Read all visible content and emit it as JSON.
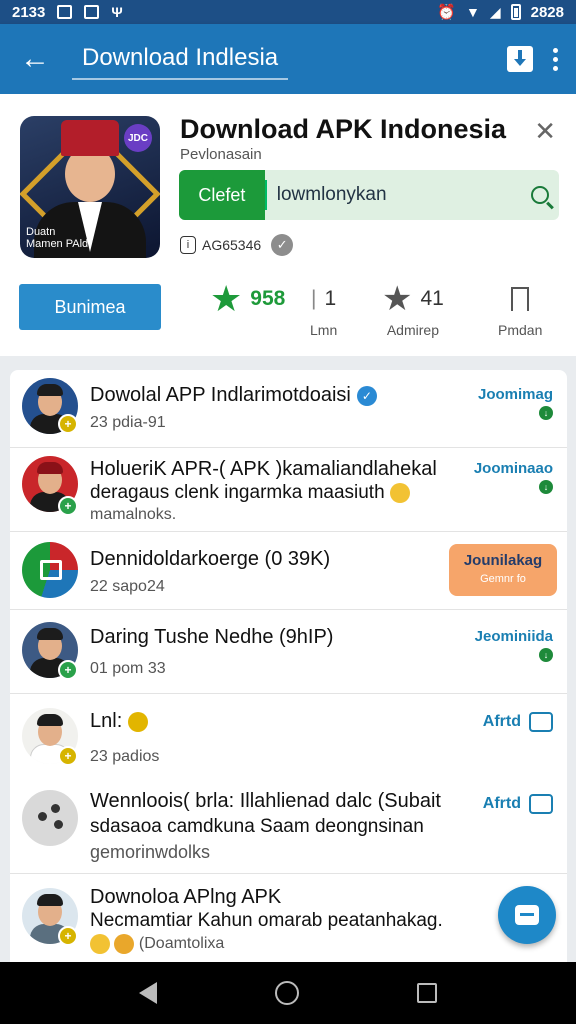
{
  "status_bar": {
    "time": "2133",
    "clock_right": "2828"
  },
  "app_bar": {
    "title": "Download Indlesia"
  },
  "header": {
    "app_title": "Download APK Indonesia",
    "developer": "Pevlonasain",
    "icon_badge": "JDC",
    "icon_caption_1": "Duatn",
    "icon_caption_2": "Mamen PAld",
    "search_button": "Clefet",
    "search_value": "lowmlonykan",
    "meta_code": "AG65346",
    "install_label": "Bunimea",
    "stats": [
      {
        "value": "958",
        "label": ""
      },
      {
        "value": "1",
        "label": "Lmn"
      },
      {
        "value": "41",
        "label": "Admirep"
      },
      {
        "value": "",
        "label": "Pmdan"
      }
    ]
  },
  "list": {
    "items": [
      {
        "title": "Dowolal APP Indlarimotdoaisi",
        "subtitle": "23 pdia-91",
        "action": "Joomimag"
      },
      {
        "title": "HolueriK APR-( APK )kamaliandlahekal",
        "desc": "deragaus clenk ingarmka maasiuth",
        "subtitle": "mamalnoks.",
        "action": "Joominaao"
      },
      {
        "title": "Dennidoldarkoerge (0 39K)",
        "subtitle": "22 sapo24",
        "action": "Jounilakag",
        "action_sub": "Gemnr fo"
      },
      {
        "title": "Daring Tushe Nedhe (9hIP)",
        "subtitle": "01 pom 33",
        "action": "Jeominiida"
      },
      {
        "title": "Lnl:",
        "subtitle": "23 padios",
        "action": "Afrtd"
      },
      {
        "title": "Wennloois( brla: Illahlienad dalc (Subait",
        "desc": "sdasaoa camdkuna Saam deongnsinan",
        "subtitle": "gemorinwdolks",
        "action": "Afrtd"
      },
      {
        "title": "Downoloa APlng APK",
        "desc": "Necmamtiar Kahun omarab peatanhakag.",
        "subtitle": "(Doamtolixa"
      }
    ]
  },
  "colors": {
    "app_bar": "#1e76b8",
    "status_bar": "#1d4f86",
    "accent_green": "#1c9a3a",
    "install_blue": "#2a8ccb",
    "action_orange": "#f6a56a"
  },
  "icons": [
    "back-arrow-icon",
    "download-icon",
    "more-icon",
    "close-icon",
    "search-icon",
    "star-icon",
    "bookmark-icon",
    "chat-icon",
    "compose-icon"
  ]
}
